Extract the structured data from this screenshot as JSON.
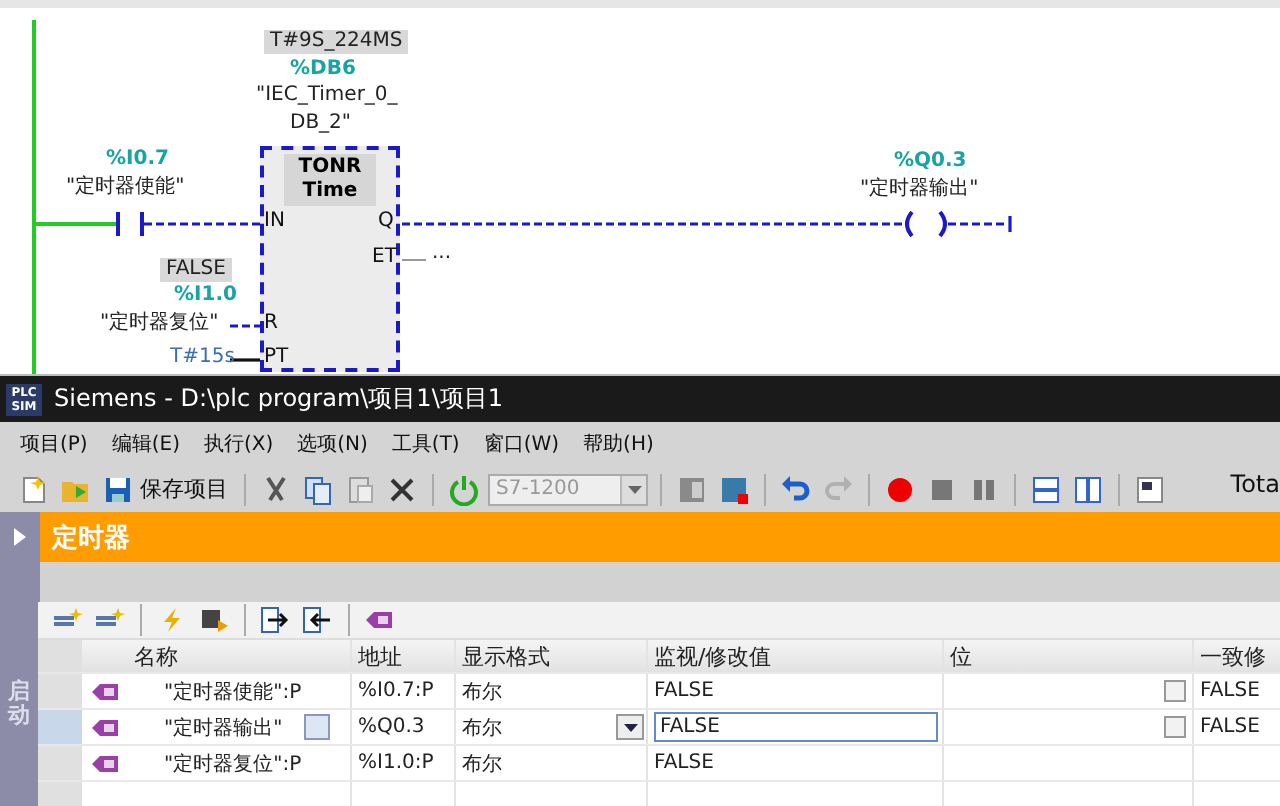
{
  "diagram": {
    "instance": {
      "current_value": "T#9S_224MS",
      "address": "%DB6",
      "name_lines": [
        "\"IEC_Timer_0_",
        "DB_2\""
      ]
    },
    "block": {
      "type": "TONR",
      "subtitle": "Time",
      "left_pins": [
        "IN",
        "R",
        "PT"
      ],
      "right_pins": [
        "Q",
        "ET"
      ]
    },
    "contact": {
      "address": "%I0.7",
      "name": "\"定时器使能\""
    },
    "reset": {
      "value": "FALSE",
      "address": "%I1.0",
      "name": "\"定时器复位\""
    },
    "preset": "T#15s",
    "et_value": "...",
    "coil": {
      "address": "%Q0.3",
      "name": "\"定时器输出\""
    }
  },
  "window": {
    "logo": [
      "PLC",
      "SIM"
    ],
    "title": "Siemens  -  D:\\plc program\\项目1\\项目1"
  },
  "menu": [
    "项目(P)",
    "编辑(E)",
    "执行(X)",
    "选项(N)",
    "工具(T)",
    "窗口(W)",
    "帮助(H)"
  ],
  "toolbar": [
    {
      "kind": "new"
    },
    {
      "kind": "open"
    },
    {
      "kind": "save",
      "label": "保存项目"
    },
    {
      "kind": "sep"
    },
    {
      "kind": "cut"
    },
    {
      "kind": "copy"
    },
    {
      "kind": "paste"
    },
    {
      "kind": "delete"
    },
    {
      "kind": "sep"
    },
    {
      "kind": "power"
    },
    {
      "kind": "dropdown",
      "label": "S7-1200",
      "disabled": true
    },
    {
      "kind": "sep"
    },
    {
      "kind": "panel"
    },
    {
      "kind": "panel-red"
    },
    {
      "kind": "sep"
    },
    {
      "kind": "undo"
    },
    {
      "kind": "redo",
      "disabled": true
    },
    {
      "kind": "sep"
    },
    {
      "kind": "record"
    },
    {
      "kind": "stop"
    },
    {
      "kind": "pause"
    },
    {
      "kind": "sep"
    },
    {
      "kind": "split-h"
    },
    {
      "kind": "split-v"
    },
    {
      "kind": "sep"
    },
    {
      "kind": "window"
    }
  ],
  "toolbar_right_text": "Tota",
  "section_title": "定时器",
  "side_tab": "启动",
  "table_toolbar": [
    {
      "kind": "add"
    },
    {
      "kind": "add"
    },
    {
      "kind": "sep"
    },
    {
      "kind": "bolt"
    },
    {
      "kind": "monitor"
    },
    {
      "kind": "sep"
    },
    {
      "kind": "in"
    },
    {
      "kind": "out"
    },
    {
      "kind": "sep"
    },
    {
      "kind": "tag"
    }
  ],
  "table": {
    "columns": [
      "名称",
      "地址",
      "显示格式",
      "监视/修改值",
      "位",
      "一致修"
    ],
    "rows": [
      {
        "name": "\"定时器使能\":P",
        "address": "%I0.7:P",
        "format": "布尔",
        "value": "FALSE",
        "bit_checked": false,
        "consistent": "FALSE",
        "selected": false
      },
      {
        "name": "\"定时器输出\"",
        "address": "%Q0.3",
        "format": "布尔",
        "value": "FALSE",
        "bit_checked": false,
        "consistent": "FALSE",
        "selected": true
      },
      {
        "name": "\"定时器复位\":P",
        "address": "%I1.0:P",
        "format": "布尔",
        "value": "FALSE",
        "selected": false
      }
    ]
  }
}
